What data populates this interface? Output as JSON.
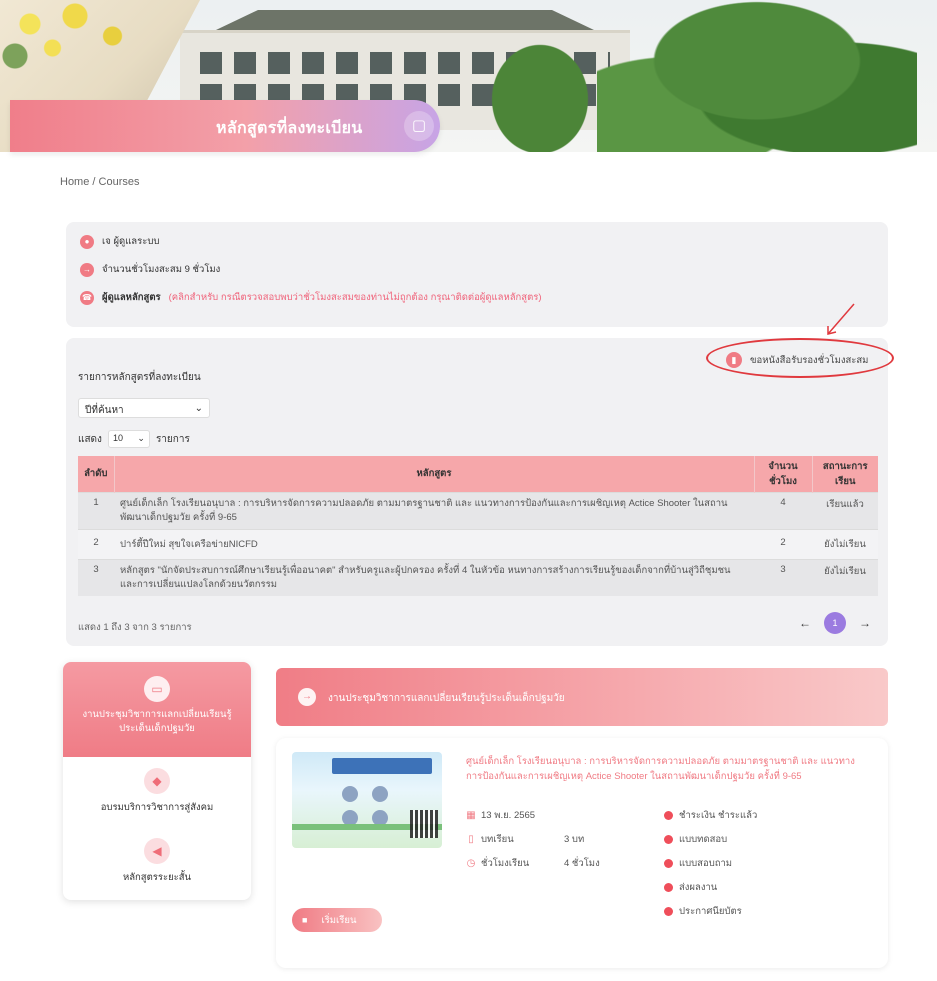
{
  "header": {
    "title": "หลักสูตรที่ลงทะเบียน",
    "icon": "chat-bubble-icon"
  },
  "breadcrumb": {
    "home": "Home",
    "separator": "/",
    "current": "Courses"
  },
  "info": {
    "user": "เจ ผู้ดูแลระบบ",
    "hours": "จำนวนชั่วโมงสะสม 9 ชั่วโมง",
    "admin_label": "ผู้ดูแลหลักสูตร",
    "admin_hint": "(คลิกสำหรับ กรณีตรวจสอบพบว่าชั่วโมงสะสมของท่านไม่ถูกต้อง กรุณาติดต่อผู้ดูแลหลักสูตร)"
  },
  "panel": {
    "certificate_button": "ขอหนังสือรับรองชั่วโมงสะสม",
    "title": "รายการหลักสูตรที่ลงทะเบียน",
    "year_select": "ปีที่ค้นหา",
    "show_prefix": "แสดง",
    "show_value": "10",
    "show_suffix": "รายการ",
    "columns": {
      "no": "ลำดับ",
      "course": "หลักสูตร",
      "hours": "จำนวน ชั่วโมง",
      "status": "สถานะการ เรียน"
    },
    "rows": [
      {
        "no": "1",
        "course": "ศูนย์เด็กเล็ก โรงเรียนอนุบาล : การบริหารจัดการความปลอดภัย ตามมาตรฐานชาติ และ แนวทางการป้องกันและการเผชิญเหตุ Actice Shooter ในสถานพัฒนาเด็กปฐมวัย ครั้งที่ 9-65",
        "hours": "4",
        "status": "เรียนแล้ว"
      },
      {
        "no": "2",
        "course": "ปาร์ตี้ปีใหม่ สุขใจเครือข่ายNICFD",
        "hours": "2",
        "status": "ยังไม่เรียน"
      },
      {
        "no": "3",
        "course": "หลักสูตร \"นักจัดประสบการณ์ศึกษาเรียนรู้เพื่ออนาคต\" สำหรับครูและผู้ปกครอง ครั้งที่ 4 ในหัวข้อ หนทางการสร้างการเรียนรู้ของเด็กจากที่บ้านสู่วิถีชุมชน และการเปลี่ยนแปลงโลกด้วยนวัตกรรม",
        "hours": "3",
        "status": "ยังไม่เรียน"
      }
    ],
    "footer": "แสดง 1 ถึง 3 จาก 3 รายการ",
    "page": "1",
    "prev_icon": "arrow-left-icon",
    "next_icon": "arrow-right-icon"
  },
  "sidebar": {
    "items": [
      {
        "label": "งานประชุมวิชาการแลกเปลี่ยนเรียนรู้ ประเด็นเด็กปฐมวัย",
        "icon": "chat-icon",
        "active": true
      },
      {
        "label": "อบรมบริการวิชาการสู่สังคม",
        "icon": "cube-icon",
        "active": false
      },
      {
        "label": "หลักสูตรระยะสั้น",
        "icon": "megaphone-icon",
        "active": false
      }
    ]
  },
  "section": {
    "title": "งานประชุมวิชาการแลกเปลี่ยนเรียนรู้ประเด็นเด็กปฐมวัย"
  },
  "course": {
    "title": "ศูนย์เด็กเล็ก โรงเรียนอนุบาล : การบริหารจัดการความปลอดภัย ตามมาตรฐานชาติ และ แนวทางการป้องกันและการเผชิญเหตุ Actice Shooter ในสถานพัฒนาเด็กปฐมวัย ครั้งที่ 9-65",
    "date": "13 พ.ย. 2565",
    "lessons_label": "บทเรียน",
    "lessons_value": "3 บท",
    "hours_label": "ชั่วโมงเรียน",
    "hours_value": "4 ชั่วโมง",
    "checklist": [
      "ชำระเงิน ชำระแล้ว",
      "แบบทดสอบ",
      "แบบสอบถาม",
      "ส่งผลงาน",
      "ประกาศนียบัตร"
    ],
    "start_button": "เริ่มเรียน"
  },
  "colors": {
    "accent": "#f07b84",
    "purple": "#9b7be0",
    "annotation": "#e0393e"
  }
}
